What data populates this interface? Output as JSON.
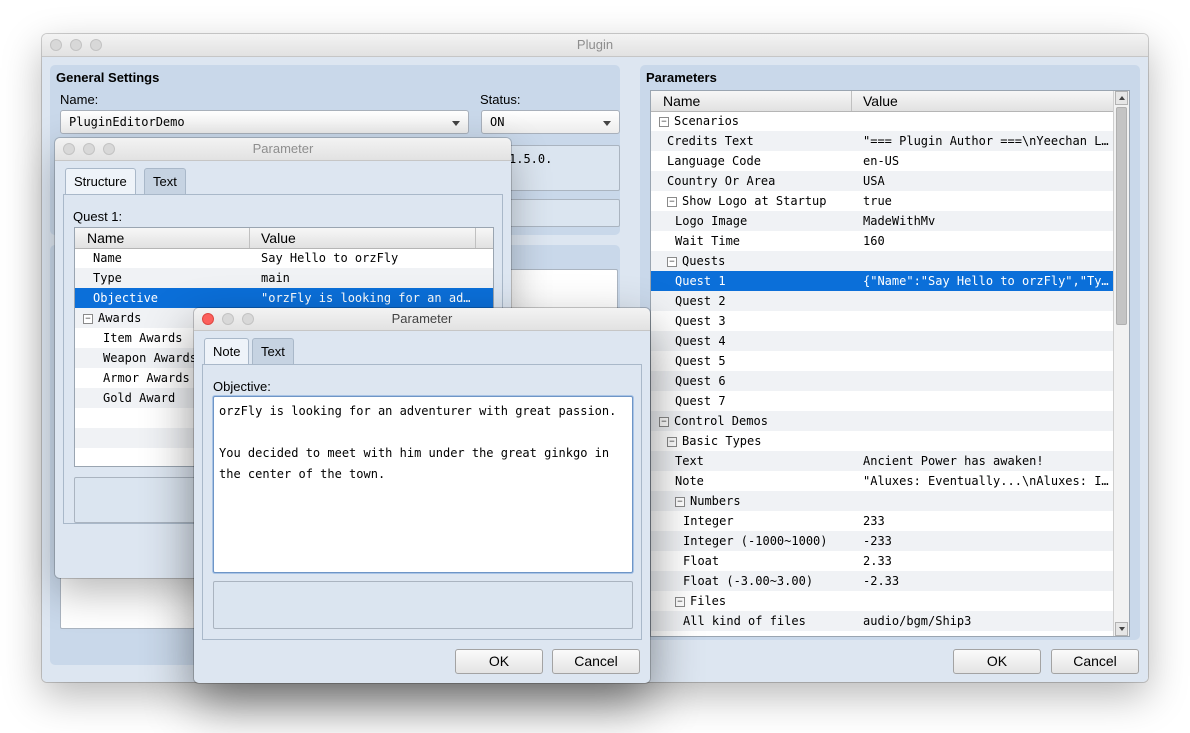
{
  "main_window": {
    "title": "Plugin",
    "general_settings": {
      "heading": "General Settings",
      "name_label": "Name:",
      "name_value": "PluginEditorDemo",
      "status_label": "Status:",
      "status_value": "ON",
      "version_fragment": "1.5.0."
    },
    "parameters": {
      "heading": "Parameters",
      "col_name": "Name",
      "col_value": "Value",
      "rows": [
        {
          "name": "Scenarios",
          "value": "",
          "indent": 0,
          "exp": true
        },
        {
          "name": "Credits Text",
          "value": "\"=== Plugin Author ===\\nYeechan L…",
          "indent": 1
        },
        {
          "name": "Language Code",
          "value": "en-US",
          "indent": 1
        },
        {
          "name": "Country Or Area",
          "value": "USA",
          "indent": 1
        },
        {
          "name": "Show Logo at Startup",
          "value": "true",
          "indent": 1,
          "exp": true
        },
        {
          "name": "Logo Image",
          "value": "MadeWithMv",
          "indent": 2
        },
        {
          "name": "Wait Time",
          "value": "160",
          "indent": 2
        },
        {
          "name": "Quests",
          "value": "",
          "indent": 1,
          "exp": true
        },
        {
          "name": "Quest 1",
          "value": "{\"Name\":\"Say Hello to orzFly\",\"Ty…",
          "indent": 2,
          "selected": true
        },
        {
          "name": "Quest 2",
          "value": "",
          "indent": 2
        },
        {
          "name": "Quest 3",
          "value": "",
          "indent": 2
        },
        {
          "name": "Quest 4",
          "value": "",
          "indent": 2
        },
        {
          "name": "Quest 5",
          "value": "",
          "indent": 2
        },
        {
          "name": "Quest 6",
          "value": "",
          "indent": 2
        },
        {
          "name": "Quest 7",
          "value": "",
          "indent": 2
        },
        {
          "name": "Control Demos",
          "value": "",
          "indent": 0,
          "exp": true
        },
        {
          "name": "Basic Types",
          "value": "",
          "indent": 1,
          "exp": true
        },
        {
          "name": "Text",
          "value": "Ancient Power has awaken!",
          "indent": 2
        },
        {
          "name": "Note",
          "value": "\"Aluxes: Eventually...\\nAluxes: I…",
          "indent": 2
        },
        {
          "name": "Numbers",
          "value": "",
          "indent": 2,
          "exp": true
        },
        {
          "name": "Integer",
          "value": "233",
          "indent": 3
        },
        {
          "name": "Integer (-1000~1000)",
          "value": "-233",
          "indent": 3
        },
        {
          "name": "Float",
          "value": "2.33",
          "indent": 3
        },
        {
          "name": "Float (-3.00~3.00)",
          "value": "-2.33",
          "indent": 3
        },
        {
          "name": "Files",
          "value": "",
          "indent": 2,
          "exp": true
        },
        {
          "name": "All kind of files",
          "value": "audio/bgm/Ship3",
          "indent": 3
        }
      ]
    },
    "ok_label": "OK",
    "cancel_label": "Cancel"
  },
  "param_window_1": {
    "title": "Parameter",
    "tab_structure": "Structure",
    "tab_text": "Text",
    "group_label": "Quest 1:",
    "col_name": "Name",
    "col_value": "Value",
    "rows": [
      {
        "name": "Name",
        "value": "Say Hello to orzFly",
        "indent": 1
      },
      {
        "name": "Type",
        "value": "main",
        "indent": 1
      },
      {
        "name": "Objective",
        "value": "\"orzFly is looking for an ad…",
        "indent": 1,
        "selected": true
      },
      {
        "name": "Awards",
        "value": "",
        "indent": 0,
        "exp": true
      },
      {
        "name": "Item Awards",
        "value": "",
        "indent": 2
      },
      {
        "name": "Weapon Awards",
        "value": "",
        "indent": 2
      },
      {
        "name": "Armor Awards",
        "value": "",
        "indent": 2
      },
      {
        "name": "Gold Award",
        "value": "",
        "indent": 2
      }
    ]
  },
  "param_window_2": {
    "title": "Parameter",
    "tab_note": "Note",
    "tab_text": "Text",
    "field_label": "Objective:",
    "text_line1": "orzFly is looking for an adventurer with great passion.",
    "text_line2": "You decided to meet with him under the great ginkgo in",
    "text_line3": "the center of the town.",
    "ok_label": "OK",
    "cancel_label": "Cancel"
  },
  "colors": {
    "selection": "#0b6fd9",
    "panel": "#c9d8ea",
    "window_bg": "#dde6f1"
  }
}
